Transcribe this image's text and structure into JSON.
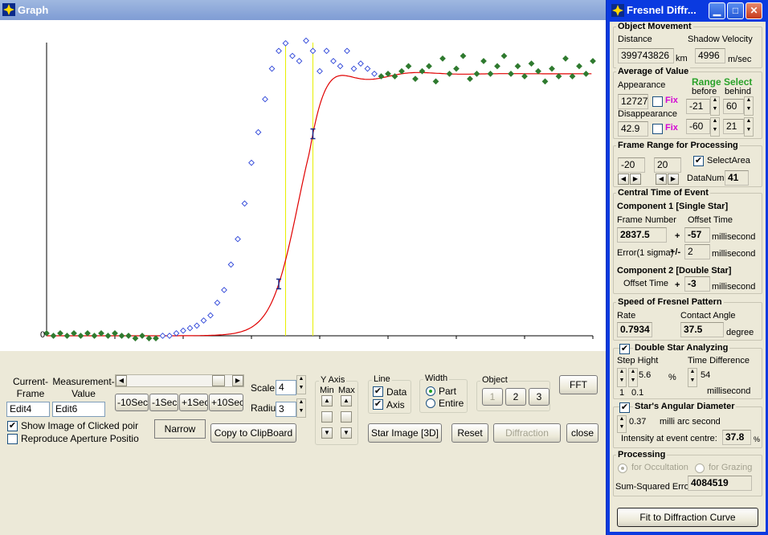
{
  "main_window": {
    "title": "Graph"
  },
  "plot": {
    "y_zero_label": "0",
    "colors": {
      "fit": "#e00000",
      "data_point": "#2a42d8",
      "excluded_point": "#2f7a2f",
      "marker_line": "#e8f000",
      "axis": "#000000"
    }
  },
  "chart_data": {
    "type": "scatter",
    "title": "",
    "xlabel": "",
    "ylabel": "",
    "y_tick_labels": [
      "0"
    ],
    "x_range": [
      -20,
      20
    ],
    "y_range": [
      0,
      1.2
    ],
    "marker_lines_x": [
      -2.5,
      -0.5
    ],
    "error_bars_x": [
      -3,
      -0.5
    ],
    "series": [
      {
        "style": "points",
        "x": [
          -20,
          -19.5,
          -19,
          -18.5,
          -18,
          -17.5,
          -17,
          -16.5,
          -16,
          -15.5,
          -15,
          -14.5,
          -14,
          -13.5,
          -13,
          -12.5,
          -12,
          -11.5,
          -11,
          -10.5,
          -10,
          -9.5,
          -9,
          -8.5,
          -8,
          -7.5,
          -7,
          -6.5,
          -6,
          -5.5,
          -5,
          -4.5,
          -4,
          -3.5,
          -3,
          -2.5,
          -2,
          -1.5,
          -1,
          -0.5,
          0,
          0.5,
          1,
          1.5,
          2,
          2.5,
          3,
          3.5,
          4,
          4.5,
          5,
          5.5,
          6,
          6.5,
          7,
          7.5,
          8,
          8.5,
          9,
          9.5,
          10,
          10.5,
          11,
          11.5,
          12,
          12.5,
          13,
          13.5,
          14,
          14.5,
          15,
          15.5,
          16,
          16.5,
          17,
          17.5,
          18,
          18.5,
          19,
          19.5,
          20
        ],
        "y": [
          0.01,
          0.0,
          0.01,
          0.0,
          0.01,
          0.0,
          0.01,
          0.0,
          0.01,
          0.0,
          0.01,
          0.0,
          0.0,
          -0.01,
          0.0,
          -0.01,
          -0.01,
          0.0,
          0.0,
          0.01,
          0.02,
          0.03,
          0.04,
          0.06,
          0.08,
          0.13,
          0.18,
          0.28,
          0.38,
          0.52,
          0.68,
          0.8,
          0.93,
          1.05,
          1.12,
          1.15,
          1.1,
          1.08,
          1.16,
          1.12,
          1.04,
          1.12,
          1.08,
          1.06,
          1.12,
          1.05,
          1.07,
          1.05,
          1.03,
          1.02,
          1.03,
          1.02,
          1.04,
          1.06,
          1.01,
          1.04,
          1.06,
          1.0,
          1.09,
          1.03,
          1.05,
          1.1,
          1.01,
          1.03,
          1.08,
          1.03,
          1.06,
          1.1,
          1.03,
          1.06,
          1.02,
          1.07,
          1.04,
          1.0,
          1.05,
          1.02,
          1.09,
          1.02,
          1.06,
          1.03,
          1.08
        ]
      },
      {
        "style": "line",
        "name": ""
      }
    ]
  },
  "controls": {
    "current_frame_label": "Current-\nFrame",
    "measurement_value_label": "Measurement-\nValue",
    "edit4": "Edit4",
    "edit6": "Edit6",
    "btn_m10": "-10Sec",
    "btn_m1": "-1Sec",
    "btn_p1": "+1Sec",
    "btn_p10": "+10Sec",
    "scale_label": "Scale",
    "scale_value": "4",
    "radius_label": "Radiu",
    "radius_value": "3",
    "show_image_label": "Show Image of Clicked poir",
    "reproduce_label": "Reproduce Aperture Positio",
    "narrow_label": "Narrow",
    "copy_label": "Copy to ClipBoard",
    "y_axis_title": "Y Axis",
    "min_label": "Min",
    "max_label": "Max",
    "line_title": "Line",
    "data_label": "Data",
    "axis_label": "Axis",
    "width_title": "Width",
    "part_label": "Part",
    "entire_label": "Entire",
    "object_title": "Object",
    "obj1": "1",
    "obj2": "2",
    "obj3": "3",
    "fft_label": "FFT",
    "star_image_label": "Star Image [3D]",
    "reset_label": "Reset",
    "diffraction_label": "Diffraction",
    "close_label": "close"
  },
  "panel": {
    "title": "Fresnel Diffr...",
    "object_movement": {
      "title": "Object Movement",
      "distance_label": "Distance",
      "distance_value": "399743826",
      "distance_unit": "km",
      "velocity_label": "Shadow Velocity",
      "velocity_value": "4996",
      "velocity_unit": "m/sec"
    },
    "average": {
      "title": "Average of Value",
      "range_select": "Range Select",
      "before": "before",
      "behind": "behind",
      "appearance_label": "Appearance",
      "appearance_value": "12727.",
      "fix": "Fix",
      "app_before": "-21",
      "app_behind": "60",
      "disappearance_label": "Disappearance",
      "disappearance_value": "42.9",
      "dis_before": "-60",
      "dis_behind": "21"
    },
    "frame_range": {
      "title": "Frame Range for Processing",
      "from": "-20",
      "to": "20",
      "select_area": "SelectArea",
      "datanum_label": "DataNum",
      "datanum_value": "41"
    },
    "central_time": {
      "title": "Central Time of  Event",
      "comp1": "Component 1  [Single Star]",
      "frame_number_label": "Frame Number",
      "frame_number_value": "2837.5",
      "offset_time_label": "Offset Time",
      "plus": "+",
      "offset_value": "-57",
      "ms": "millisecond",
      "error_label": "Error(1 sigma)",
      "pm": "+/-",
      "error_value": "2",
      "comp2": "Component 2   [Double Star]",
      "offset2_label": "Offset Time",
      "offset2_value": "-3"
    },
    "speed": {
      "title": "Speed of Fresnel Pattern",
      "rate_label": "Rate",
      "rate_value": "0.7934",
      "contact_label": "Contact Angle",
      "contact_value": "37.5",
      "degree": "degree"
    },
    "double_star": {
      "title": "Double Star Analyzing",
      "step_label": "Step Hight",
      "step_value": "5.6",
      "percent": "%",
      "step1": "1",
      "step01": "0.1",
      "timediff_label": "Time Difference",
      "timediff_value": "54",
      "ms": "millisecond"
    },
    "angular": {
      "title": "Star's Angular Diameter",
      "value": "0.37",
      "unit": "milli arc second",
      "intensity_label": "Intensity at event centre:",
      "intensity_value": "37.8",
      "percent": "%"
    },
    "processing": {
      "title": "Processing",
      "occultation": "for Occultation",
      "grazing": "for Grazing",
      "sse_label": "Sum-Squared Error",
      "sse_value": "4084519"
    },
    "fit_button": "Fit to Diffraction Curve"
  }
}
